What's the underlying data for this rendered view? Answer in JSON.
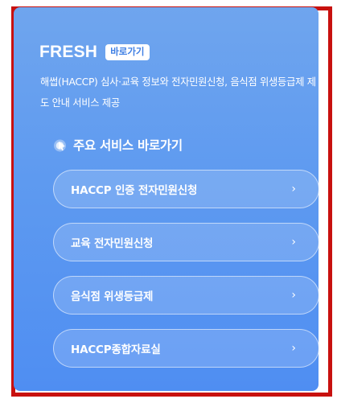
{
  "header": {
    "title": "FRESH",
    "goto_badge": "바로가기",
    "description": "해썹(HACCP) 심사·교육 정보와 전자민원신청, 음식점 위생등급제 제도 안내 서비스 제공"
  },
  "section": {
    "icon": "pointer-icon",
    "title": "주요 서비스 바로가기"
  },
  "services": [
    {
      "label": "HACCP 인증 전자민원신청",
      "chevron": "›"
    },
    {
      "label": "교육 전자민원신청",
      "chevron": "›"
    },
    {
      "label": "음식점 위생등급제",
      "chevron": "›"
    },
    {
      "label": "HACCP종합자료실",
      "chevron": "›"
    }
  ],
  "colors": {
    "frame_border": "#c8110f",
    "panel_top": "#6fa5ee",
    "panel_bottom": "#4f8ef2",
    "badge_text": "#3f7fe4"
  }
}
